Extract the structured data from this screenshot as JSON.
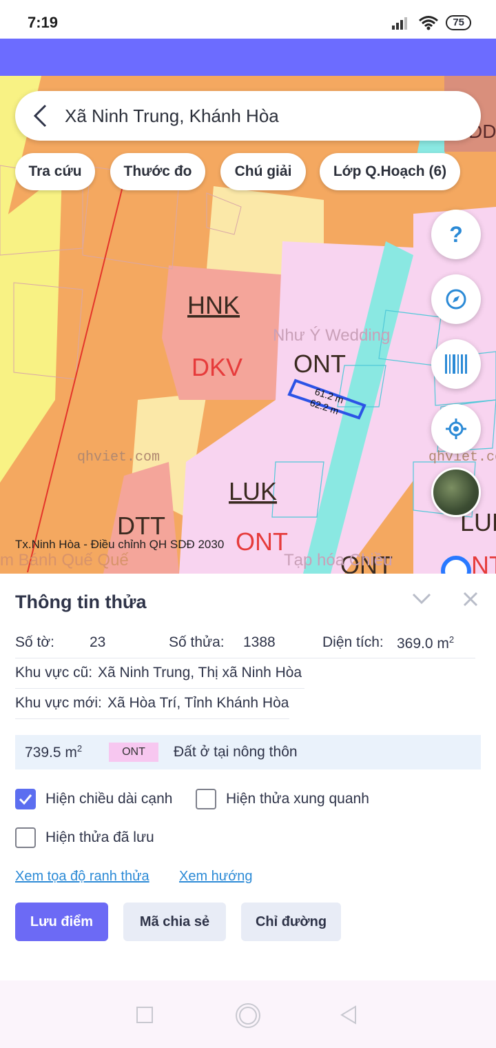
{
  "status": {
    "time": "7:19",
    "battery": "75"
  },
  "search": {
    "location": "Xã Ninh Trung, Khánh Hòa"
  },
  "chips": [
    {
      "label": "Tra cứu"
    },
    {
      "label": "Thước đo"
    },
    {
      "label": "Chú giải"
    },
    {
      "label": "Lớp Q.Hoạch (6)"
    }
  ],
  "map": {
    "labels": {
      "hnk": "HNK",
      "dkv": "DKV",
      "ont1": "ONT",
      "luk": "LUK",
      "ont2": "ONT",
      "dtt": "DTT",
      "ont3": "ONT",
      "luk_right": "LUK",
      "nt_right": "NT",
      "poi_wedding": "Như Ý Wedding",
      "poi_shop": "Tạp hóa Chiều",
      "poi_banh": "m Bánh Quế Quế",
      "watermark1": "qhviet.com",
      "watermark2": "qhviet.com",
      "edge1": "61.2 m",
      "edge2": "62.2 m",
      "corner_text": "DD"
    },
    "footer": "Tx.Ninh Hòa - Điều chỉnh QH SDĐ 2030",
    "fab_help": "?",
    "colors": {
      "orange": "#f4a860",
      "salmon": "#f4a59a",
      "pink": "#f8d4f0",
      "cream": "#fbe8a8",
      "yellow": "#f8f284",
      "cyan": "#8ae8e2"
    }
  },
  "panel": {
    "title": "Thông tin thửa",
    "so_to_label": "Số tờ:",
    "so_to_value": "23",
    "so_thua_label": "Số thửa:",
    "so_thua_value": "1388",
    "dien_tich_label": "Diện tích:",
    "dien_tich_value": "369.0 m",
    "dien_tich_unit_sup": "2",
    "khu_vuc_cu_label": "Khu vực cũ:",
    "khu_vuc_cu_value": "Xã Ninh Trung, Thị xã Ninh Hòa",
    "khu_vuc_moi_label": "Khu vực mới:",
    "khu_vuc_moi_value": "Xã Hòa Trí, Tỉnh Khánh Hòa",
    "zone": {
      "area": "739.5 m",
      "area_sup": "2",
      "code": "ONT",
      "description": "Đất ở tại nông thôn"
    },
    "checkboxes": {
      "show_edge_length": {
        "label": "Hiện chiều dài cạnh",
        "checked": true
      },
      "show_surrounding": {
        "label": "Hiện thửa xung quanh",
        "checked": false
      },
      "show_saved": {
        "label": "Hiện thửa đã lưu",
        "checked": false
      }
    },
    "links": {
      "coordinates": "Xem tọa độ ranh thửa",
      "direction": "Xem hướng"
    },
    "buttons": {
      "save": "Lưu điểm",
      "share": "Mã chia sẻ",
      "directions": "Chỉ đường"
    }
  }
}
